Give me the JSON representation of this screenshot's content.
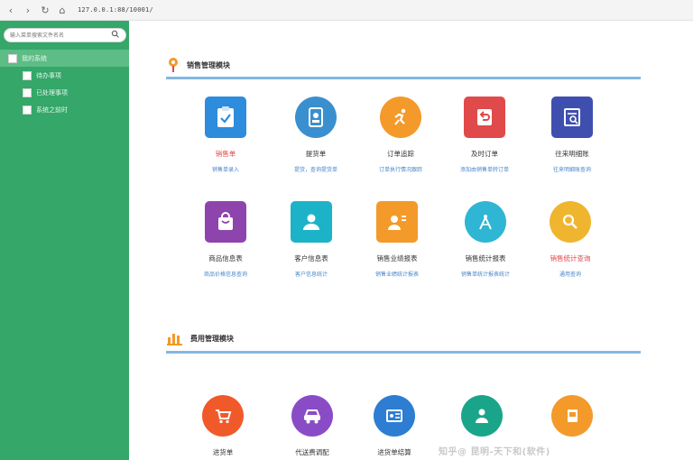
{
  "browser": {
    "url": "127.0.0.1:88/10001/"
  },
  "sidebar": {
    "search_placeholder": "输入菜单搜索文件名名",
    "tree": [
      {
        "label": "我的系统",
        "level": 0
      },
      {
        "label": "待办事项",
        "level": 1
      },
      {
        "label": "已处理事项",
        "level": 1
      },
      {
        "label": "系统之前时",
        "level": 1
      }
    ]
  },
  "sections": [
    {
      "title": "销售管理模块",
      "tiles": [
        {
          "title": "销售单",
          "sub": "销售单录入",
          "color": "#2d8cdc",
          "shape": "square",
          "icon": "clipboard-check-icon",
          "title_color": "red"
        },
        {
          "title": "提货单",
          "sub": "提货，查询提货单",
          "color": "#3a8fcf",
          "shape": "circle",
          "icon": "document-user-icon"
        },
        {
          "title": "订单追踪",
          "sub": "订单执行情况跟踪",
          "color": "#f39a2a",
          "shape": "circle",
          "icon": "running-person-icon"
        },
        {
          "title": "及时订单",
          "sub": "添加由销售单转订单",
          "color": "#e04a4a",
          "shape": "square",
          "icon": "return-arrow-icon"
        },
        {
          "title": "往来明细账",
          "sub": "往来明细账查询",
          "color": "#3f4fb0",
          "shape": "square",
          "icon": "ledger-icon"
        }
      ]
    },
    {
      "title": "",
      "tiles": [
        {
          "title": "商品信息表",
          "sub": "商品价格信息查询",
          "color": "#8e44ad",
          "shape": "square",
          "icon": "shopping-bag-icon"
        },
        {
          "title": "客户信息表",
          "sub": "客户信息统计",
          "color": "#1cb3c8",
          "shape": "square",
          "icon": "user-icon"
        },
        {
          "title": "销售业绩报表",
          "sub": "销售业绩统计报表",
          "color": "#f39a2a",
          "shape": "square",
          "icon": "id-card-icon"
        },
        {
          "title": "销售统计报表",
          "sub": "销售单统计报表统计",
          "color": "#2eb6d4",
          "shape": "circle",
          "icon": "compass-icon"
        },
        {
          "title": "销售统计查询",
          "sub": "通用查询",
          "color": "#f0b52f",
          "shape": "circle",
          "icon": "magnifier-icon",
          "title_color": "red"
        }
      ]
    },
    {
      "title": "费用管理模块",
      "tiles": [
        {
          "title": "进货单",
          "sub": "",
          "color": "#f05a2a",
          "shape": "circle",
          "icon": "cart-icon"
        },
        {
          "title": "代送费调配",
          "sub": "",
          "color": "#8a4cc6",
          "shape": "circle",
          "icon": "car-icon"
        },
        {
          "title": "进货单结算",
          "sub": "",
          "color": "#2d7dd2",
          "shape": "circle",
          "icon": "card-icon"
        },
        {
          "title": "",
          "sub": "",
          "color": "#1aa58a",
          "shape": "circle",
          "icon": "people-icon"
        },
        {
          "title": "",
          "sub": "",
          "color": "#f39a2a",
          "shape": "circle",
          "icon": "doc-icon"
        }
      ]
    }
  ],
  "watermark": "知乎@ 昆明-天下和(软件)"
}
